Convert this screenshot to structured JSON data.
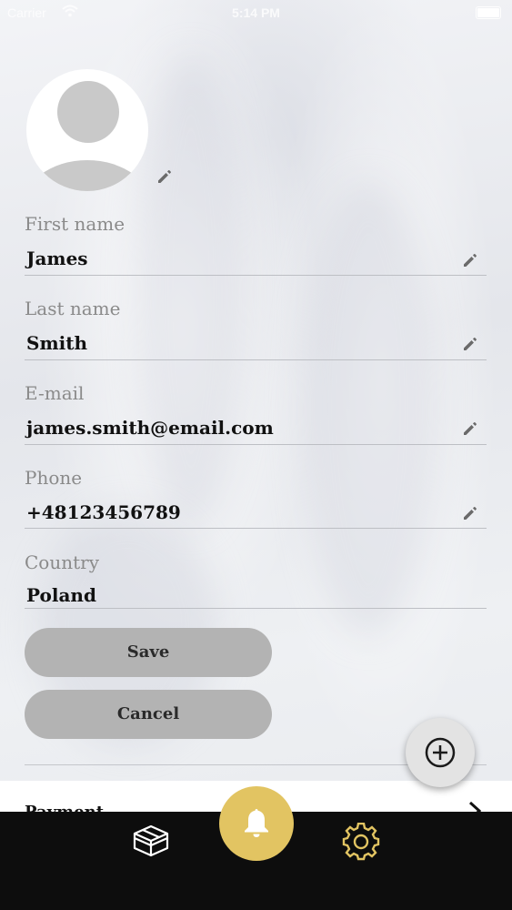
{
  "status_bar": {
    "carrier": "Carrier",
    "time": "5:14 PM"
  },
  "profile": {
    "avatar_icon": "user-avatar-icon",
    "edit_icon": "pencil-icon"
  },
  "form": {
    "first_name": {
      "label": "First name",
      "value": "James"
    },
    "last_name": {
      "label": "Last name",
      "value": "Smith"
    },
    "email": {
      "label": "E-mail",
      "value": "james.smith@email.com"
    },
    "phone": {
      "label": "Phone",
      "value": "+48123456789"
    },
    "country": {
      "label": "Country",
      "value": "Poland"
    }
  },
  "buttons": {
    "save_label": "Save",
    "cancel_label": "Cancel"
  },
  "payment": {
    "label": "Payment"
  },
  "fab": {
    "icon": "add-circle-icon"
  },
  "tabbar": {
    "items": [
      {
        "icon": "box-icon"
      },
      {
        "icon": "bell-icon"
      },
      {
        "icon": "gear-icon"
      }
    ]
  },
  "colors": {
    "accent": "#e2c462",
    "button_bg": "#b3b3b3",
    "tabbar_bg": "#0d0d0d"
  }
}
